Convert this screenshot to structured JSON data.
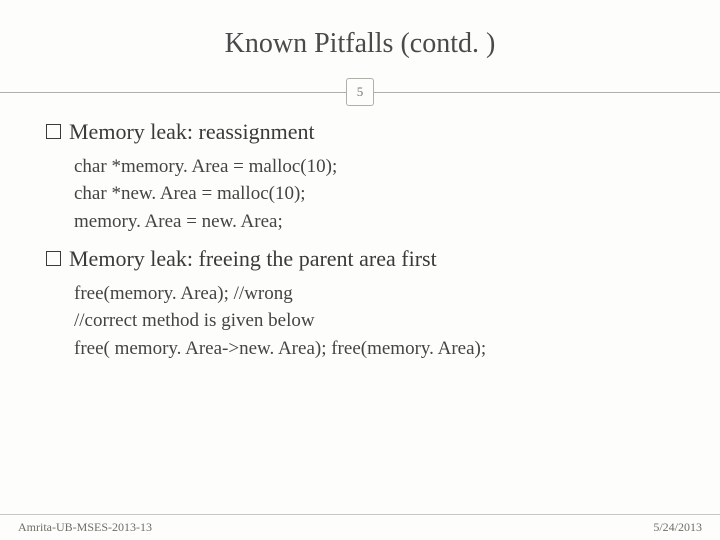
{
  "title": "Known Pitfalls (contd. )",
  "page_number": "5",
  "sections": [
    {
      "heading": "Memory leak: reassignment",
      "lines": [
        "char *memory. Area = malloc(10);",
        "char *new. Area = malloc(10);",
        "memory. Area = new. Area;"
      ]
    },
    {
      "heading": "Memory leak: freeing the parent area first",
      "lines": [
        "free(memory. Area); //wrong",
        "//correct method is given below",
        "free( memory. Area->new. Area); free(memory. Area);"
      ]
    }
  ],
  "footer": {
    "left": "Amrita-UB-MSES-2013-13",
    "right": "5/24/2013"
  }
}
